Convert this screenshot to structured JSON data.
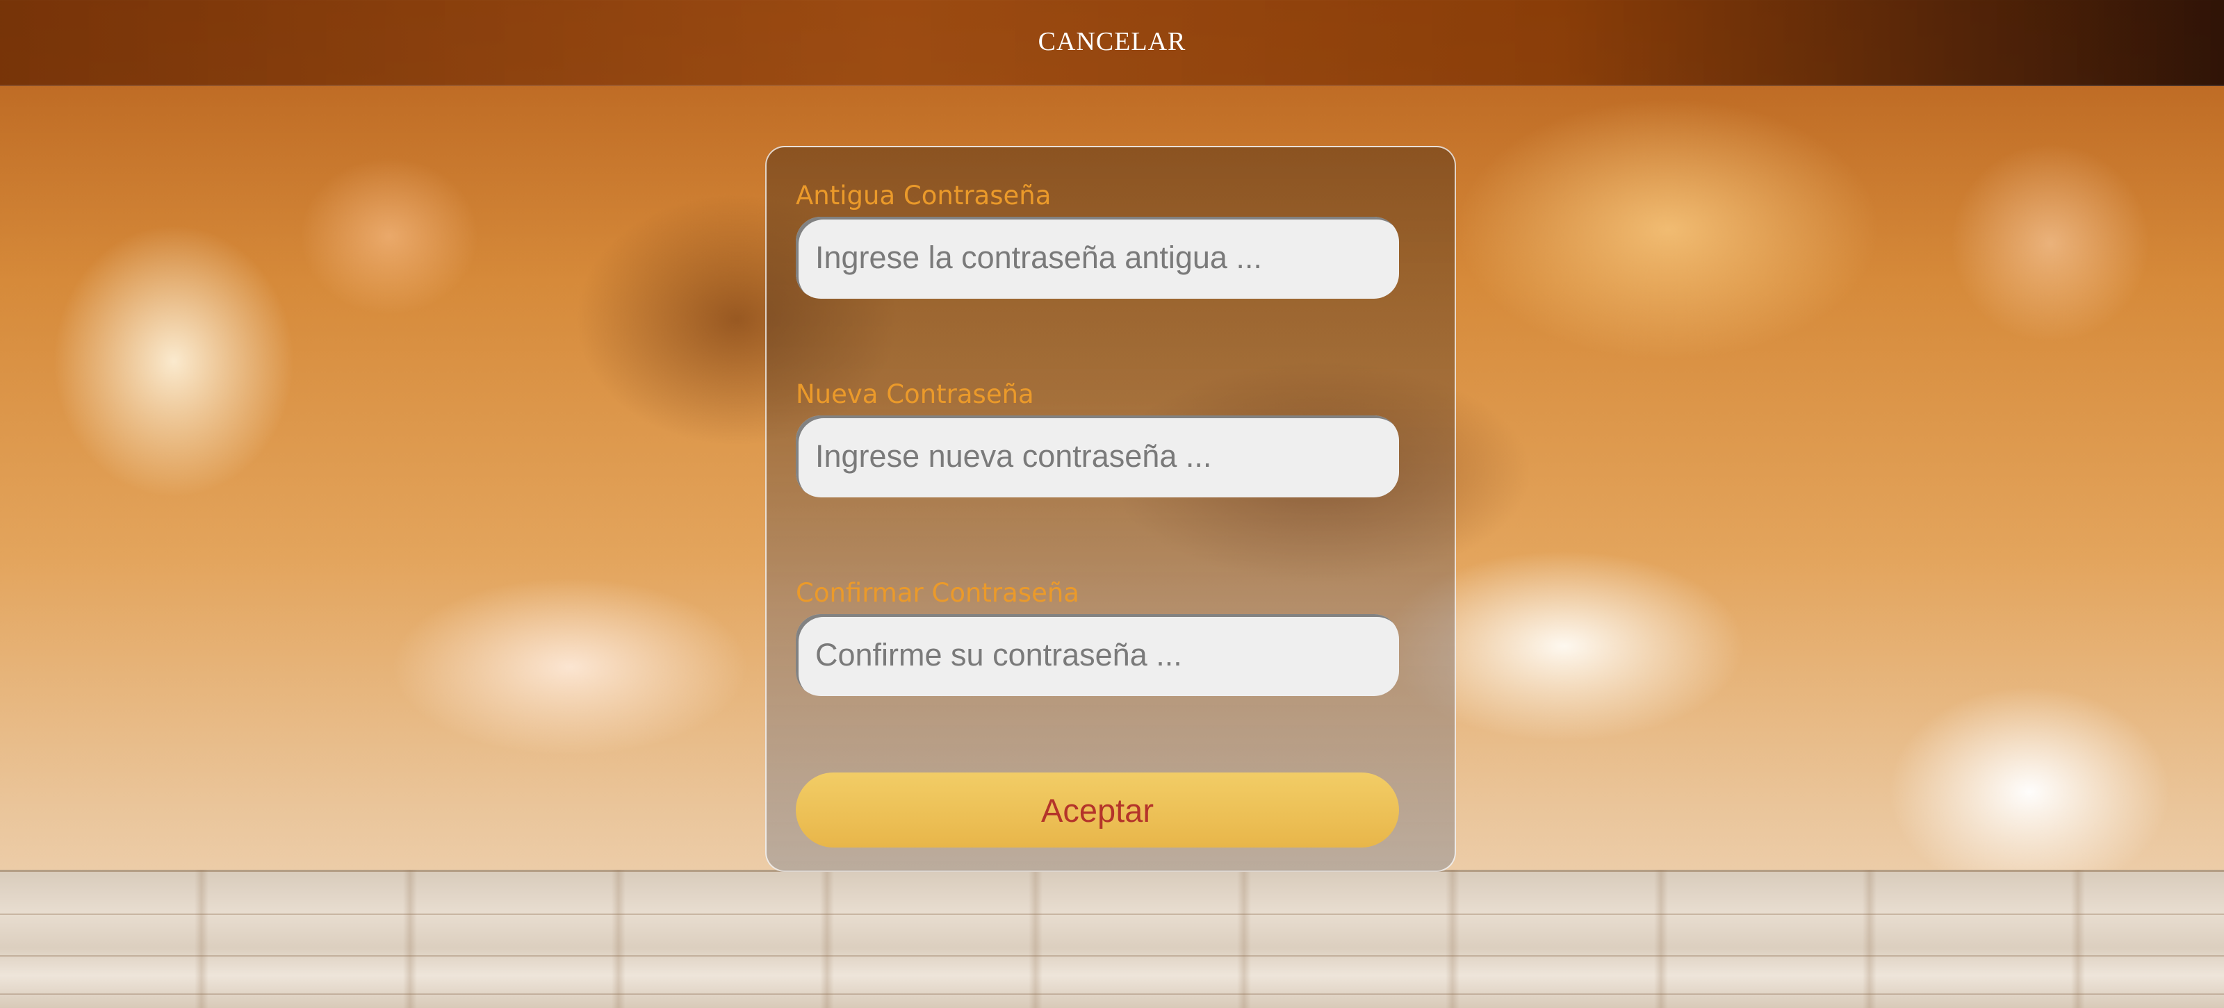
{
  "header": {
    "cancel_label": "CANCELAR"
  },
  "form": {
    "old_password": {
      "label": "Antigua Contraseña",
      "placeholder": "Ingrese la contraseña antigua ...",
      "value": ""
    },
    "new_password": {
      "label": "Nueva Contraseña",
      "placeholder": "Ingrese nueva contraseña ...",
      "value": ""
    },
    "confirm_password": {
      "label": "Confirmar Contraseña",
      "placeholder": "Confirme su contraseña ...",
      "value": ""
    },
    "submit_label": "Aceptar"
  },
  "colors": {
    "label": "#eb9a2a",
    "button_bg": "#e8b64a",
    "button_text": "#b4342a",
    "input_bg": "#efefef"
  }
}
